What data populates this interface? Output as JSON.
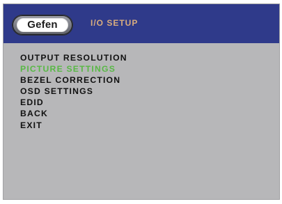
{
  "header": {
    "logo_text": "Gefen",
    "title": "I/O SETUP"
  },
  "menu": {
    "items": [
      {
        "label": "OUTPUT RESOLUTION",
        "selected": false
      },
      {
        "label": "PICTURE SETTINGS",
        "selected": true
      },
      {
        "label": "BEZEL CORRECTION",
        "selected": false
      },
      {
        "label": "OSD SETTINGS",
        "selected": false
      },
      {
        "label": "EDID",
        "selected": false
      },
      {
        "label": "BACK",
        "selected": false
      },
      {
        "label": "EXIT",
        "selected": false
      }
    ]
  },
  "colors": {
    "header_background": "#2f3a8a",
    "panel_background": "#b7b7b9",
    "title_text": "#d9ad7e",
    "selected_item": "#58b845",
    "menu_text": "#111111"
  }
}
